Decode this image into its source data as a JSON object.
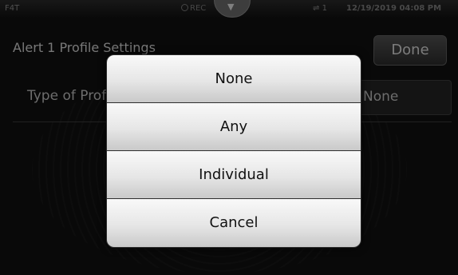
{
  "status": {
    "model": "F4T",
    "rec_label": "REC",
    "pulltab_glyph": "▼",
    "usb_glyph": "⇌",
    "usb_count": "1",
    "datetime": "12/19/2019 04:08 PM"
  },
  "page": {
    "title": "Alert 1 Profile Settings",
    "done_label": "Done",
    "row_label": "Type of Profile",
    "row_value": "None"
  },
  "picker": {
    "options": [
      "None",
      "Any",
      "Individual",
      "Cancel"
    ]
  }
}
